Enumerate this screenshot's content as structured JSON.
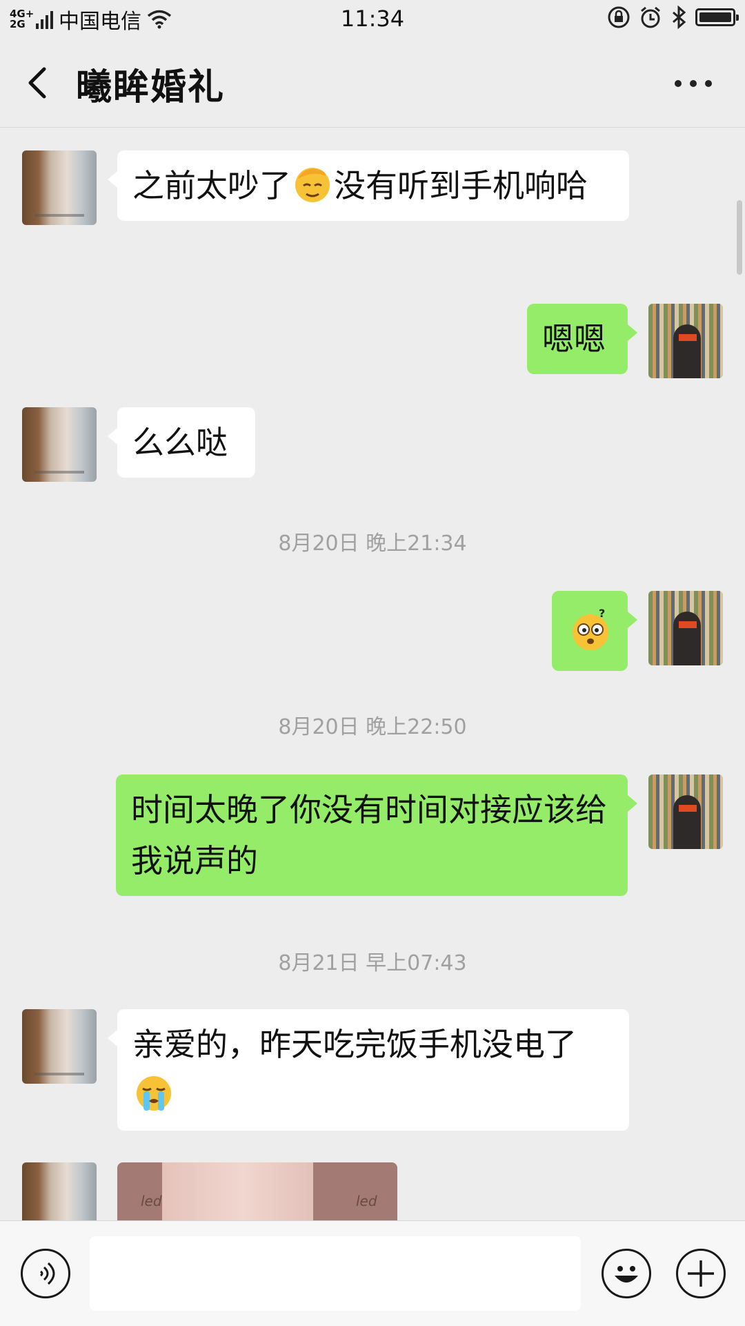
{
  "status_bar": {
    "network": "4G+ 2G",
    "carrier": "中国电信",
    "time": "11:34",
    "battery_level": 1.0
  },
  "header": {
    "title": "曦眸婚礼"
  },
  "messages": [
    {
      "side": "left",
      "type": "text",
      "text_before": "之前太吵了",
      "emoji": "face-palm-emoji",
      "text_after": "没有听到手机响哈"
    },
    {
      "side": "right",
      "type": "text",
      "text": "嗯嗯"
    },
    {
      "side": "left",
      "type": "text",
      "text": "么么哒"
    },
    {
      "type": "timestamp",
      "text": "8月20日 晚上21:34"
    },
    {
      "side": "right",
      "type": "emoji",
      "emoji": "dizzy-face-emoji"
    },
    {
      "type": "timestamp",
      "text": "8月20日 晚上22:50"
    },
    {
      "side": "right",
      "type": "text",
      "text": "时间太晚了你没有时间对接应该给我说声的"
    },
    {
      "type": "timestamp",
      "text": "8月21日 早上07:43"
    },
    {
      "side": "left",
      "type": "text",
      "text": "亲爱的，昨天吃完饭手机没电了",
      "emoji": "crying-face-emoji"
    },
    {
      "side": "left",
      "type": "image",
      "image_texts": [
        "led",
        "led"
      ]
    }
  ],
  "colors": {
    "background": "#ededed",
    "bubble_green": "#95ec69",
    "bubble_white": "#ffffff",
    "timestamp_text": "#a0a0a0"
  }
}
